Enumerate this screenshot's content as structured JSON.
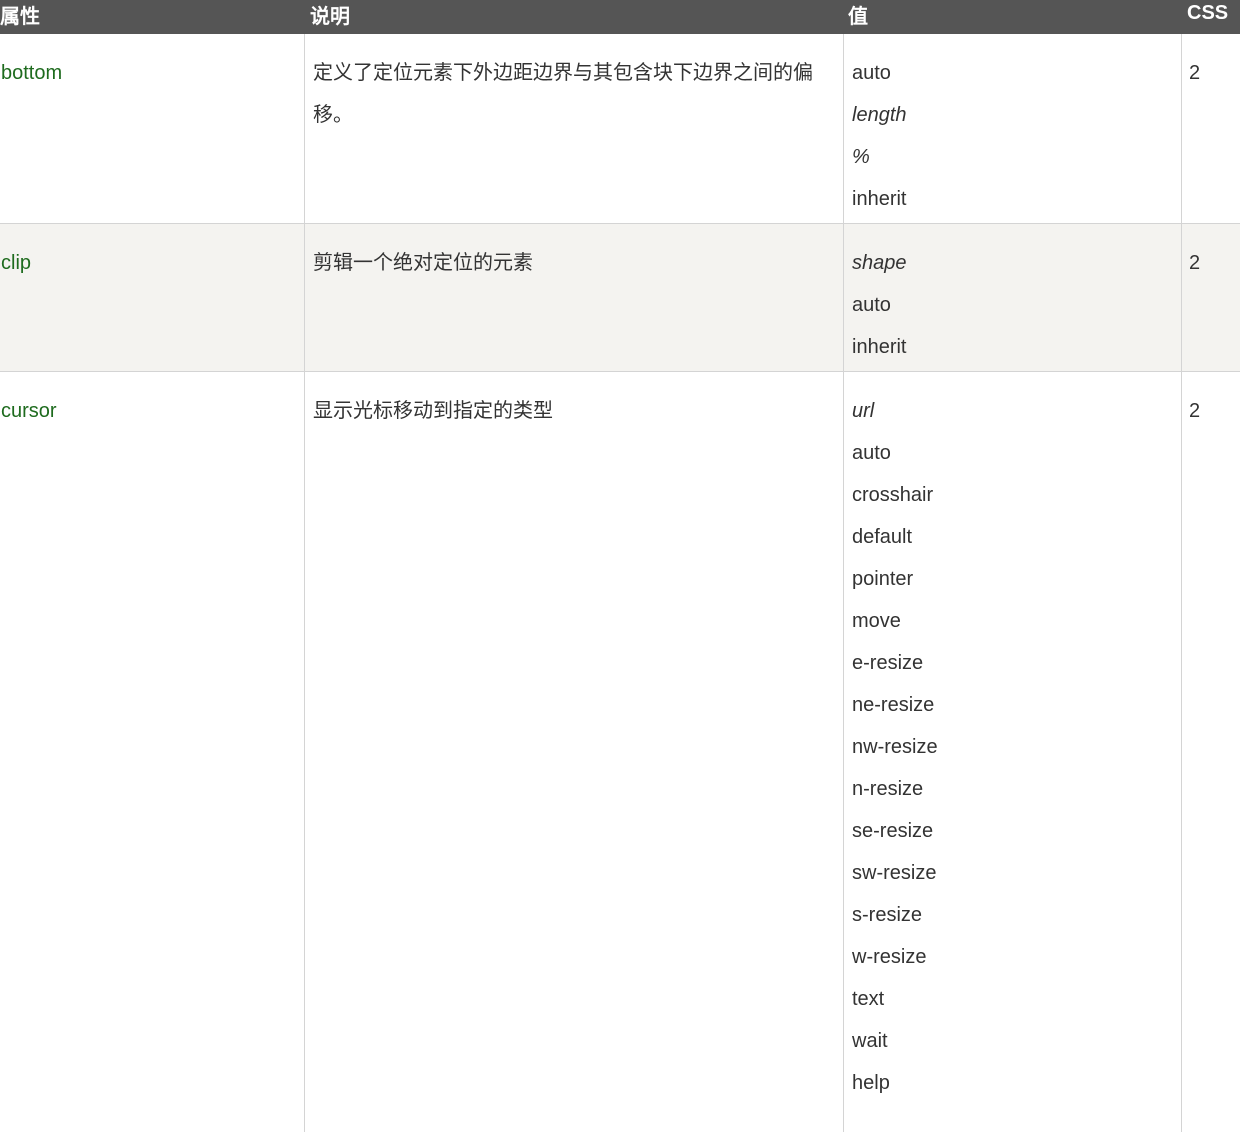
{
  "header": {
    "col_property": "属性",
    "col_description": "说明",
    "col_values": "值",
    "col_css": "CSS"
  },
  "rows": [
    {
      "property": "bottom",
      "description": "定义了定位元素下外边距边界与其包含块下边界之间的偏移。",
      "values": [
        {
          "text": "auto",
          "italic": false
        },
        {
          "text": "length",
          "italic": true
        },
        {
          "text": "%",
          "italic": true
        },
        {
          "text": "inherit",
          "italic": false
        }
      ],
      "css": "2"
    },
    {
      "property": "clip",
      "description": "剪辑一个绝对定位的元素",
      "values": [
        {
          "text": "shape",
          "italic": true
        },
        {
          "text": "auto",
          "italic": false
        },
        {
          "text": "inherit",
          "italic": false
        }
      ],
      "css": "2"
    },
    {
      "property": "cursor",
      "description": "显示光标移动到指定的类型",
      "values": [
        {
          "text": "url",
          "italic": true
        },
        {
          "text": "auto",
          "italic": false
        },
        {
          "text": "crosshair",
          "italic": false
        },
        {
          "text": "default",
          "italic": false
        },
        {
          "text": "pointer",
          "italic": false
        },
        {
          "text": "move",
          "italic": false
        },
        {
          "text": "e-resize",
          "italic": false
        },
        {
          "text": "ne-resize",
          "italic": false
        },
        {
          "text": "nw-resize",
          "italic": false
        },
        {
          "text": "n-resize",
          "italic": false
        },
        {
          "text": "se-resize",
          "italic": false
        },
        {
          "text": "sw-resize",
          "italic": false
        },
        {
          "text": "s-resize",
          "italic": false
        },
        {
          "text": "w-resize",
          "italic": false
        },
        {
          "text": "text",
          "italic": false
        },
        {
          "text": "wait",
          "italic": false
        },
        {
          "text": "help",
          "italic": false
        }
      ],
      "css": "2"
    }
  ]
}
